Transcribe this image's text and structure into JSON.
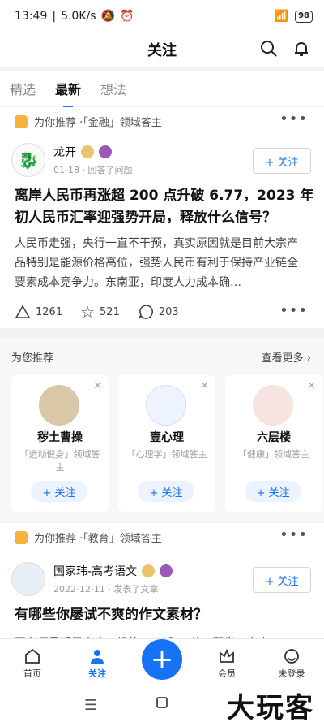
{
  "status": {
    "time": "13:49",
    "speed": "5.0K/s",
    "battery": "98"
  },
  "header": {
    "title": "关注"
  },
  "tabs": [
    {
      "label": "精选"
    },
    {
      "label": "最新"
    },
    {
      "label": "想法"
    }
  ],
  "feed": [
    {
      "recommend": "为你推荐 ·「金融」领域答主",
      "author": "龙开",
      "author_sub": "01-18 · 回答了问题",
      "follow": "+ 关注",
      "title": "离岸人民币再涨超 200 点升破 6.77，2023 年初人民币汇率迎强势开局，释放什么信号？",
      "excerpt": "人民币走强，央行一直不干预，真实原因就是目前大宗产品特别是能源价格高位，强势人民币有利于保持产业链全要素成本竞争力。东南亚，印度人力成本确…",
      "likes": "1261",
      "favorites": "521",
      "comments": "203"
    },
    {
      "recommend": "为你推荐 ·「教育」领域答主",
      "author": "国家玮-高考语文",
      "author_sub": "2022-12-11 · 发表了文章",
      "follow": "+ 关注",
      "title": "有哪些你屡试不爽的作文素材？",
      "excerpt": "国老师最近很喜欢王维的……话，\"草木蔓发，春山可"
    }
  ],
  "recommend_section": {
    "title": "为您推荐",
    "more": "查看更多",
    "users": [
      {
        "name": "秽土曹操",
        "desc": "「运动健身」领域答主",
        "follow": "+ 关注"
      },
      {
        "name": "壹心理",
        "desc": "「心理学」领域答主",
        "follow": "+ 关注"
      },
      {
        "name": "六层楼",
        "desc": "「健康」领域答主",
        "follow": "+ 关注"
      }
    ]
  },
  "bottom_nav": [
    {
      "label": "首页"
    },
    {
      "label": "关注"
    },
    {
      "label": "会员"
    },
    {
      "label": "未登录"
    }
  ],
  "watermark": "大玩客",
  "colors": {
    "accent": "#1772f6"
  }
}
